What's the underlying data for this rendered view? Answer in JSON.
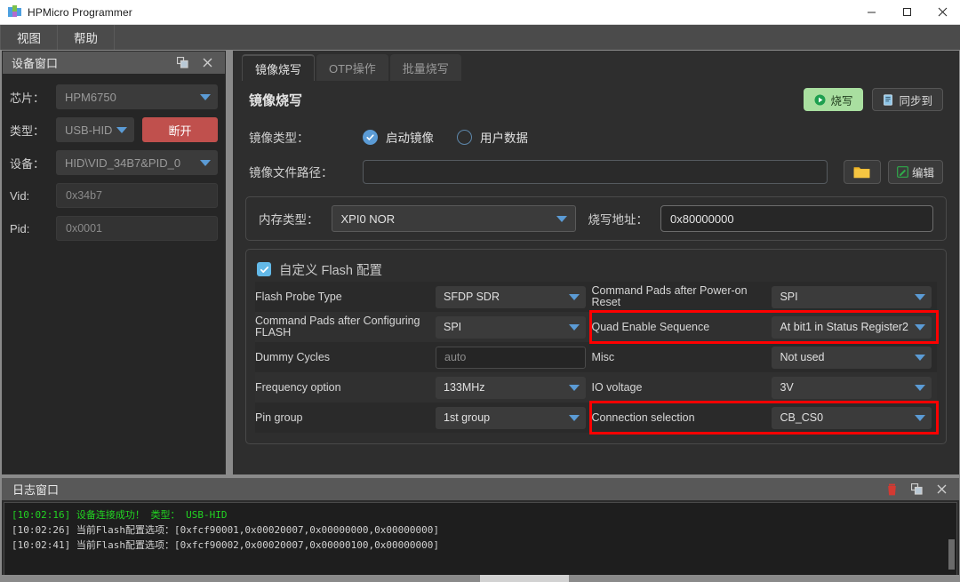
{
  "window": {
    "title": "HPMicro Programmer",
    "controls": {
      "minimize": "minimize-button",
      "maximize": "maximize-button",
      "close": "close-button"
    }
  },
  "menubar": {
    "items": [
      {
        "label": "视图"
      },
      {
        "label": "帮助"
      }
    ]
  },
  "device_panel": {
    "title": "设备窗口",
    "fields": {
      "chip_label": "芯片：",
      "chip_value": "HPM6750",
      "type_label": "类型：",
      "type_value": "USB-HID",
      "disconnect_label": "断开",
      "device_label": "设备：",
      "device_value": "HID\\VID_34B7&PID_0",
      "vid_label": "Vid:",
      "vid_value": "0x34b7",
      "pid_label": "Pid:",
      "pid_value": "0x0001"
    }
  },
  "tabs": [
    {
      "label": "镜像烧写",
      "active": true
    },
    {
      "label": "OTP操作",
      "active": false
    },
    {
      "label": "批量烧写",
      "active": false
    }
  ],
  "main": {
    "section_title": "镜像烧写",
    "burn_label": "烧写",
    "sync_label": "同步到",
    "image_type_label": "镜像类型：",
    "image_type_options": [
      {
        "label": "启动镜像",
        "selected": true
      },
      {
        "label": "用户数据",
        "selected": false
      }
    ],
    "file_path_label": "镜像文件路径：",
    "file_path_value": "",
    "browse_label": "",
    "edit_label": "编辑",
    "memory_type_label": "内存类型：",
    "memory_type_value": "XPI0 NOR",
    "burn_address_label": "烧写地址：",
    "burn_address_value": "0x80000000"
  },
  "flash_config": {
    "checkbox_checked": true,
    "title": "自定义 Flash 配置",
    "rows": [
      {
        "left": {
          "name": "Flash Probe Type",
          "value": "SFDP SDR",
          "kind": "combo",
          "highlight": false
        },
        "right": {
          "name": "Command Pads after Power-on Reset",
          "value": "SPI",
          "kind": "combo",
          "highlight": false
        }
      },
      {
        "left": {
          "name": "Command Pads after Configuring FLASH",
          "value": "SPI",
          "kind": "combo",
          "highlight": false
        },
        "right": {
          "name": "Quad Enable Sequence",
          "value": "At bit1 in Status Register2",
          "kind": "combo",
          "highlight": true
        }
      },
      {
        "left": {
          "name": "Dummy Cycles",
          "value": "auto",
          "kind": "input",
          "highlight": false
        },
        "right": {
          "name": "Misc",
          "value": "Not used",
          "kind": "combo",
          "highlight": false
        }
      },
      {
        "left": {
          "name": "Frequency option",
          "value": "133MHz",
          "kind": "combo",
          "highlight": false
        },
        "right": {
          "name": "IO voltage",
          "value": "3V",
          "kind": "combo",
          "highlight": false
        }
      },
      {
        "left": {
          "name": "Pin group",
          "value": "1st group",
          "kind": "combo",
          "highlight": false
        },
        "right": {
          "name": "Connection selection",
          "value": "CB_CS0",
          "kind": "combo",
          "highlight": true
        }
      }
    ]
  },
  "log_panel": {
    "title": "日志窗口",
    "lines": [
      {
        "text": "[10:02:16] 设备连接成功！ 类型： USB-HID",
        "level": "ok"
      },
      {
        "text": "[10:02:26] 当前Flash配置选项：[0xfcf90001,0x00020007,0x00000000,0x00000000]",
        "level": "info"
      },
      {
        "text": "[10:02:41] 当前Flash配置选项：[0xfcf90002,0x00020007,0x00000100,0x00000000]",
        "level": "info"
      }
    ]
  },
  "colors": {
    "accent": "#5b9bd5",
    "danger": "#c0504d",
    "success": "#a9dfa0",
    "highlight": "#ff0000",
    "log_ok": "#22d422"
  }
}
